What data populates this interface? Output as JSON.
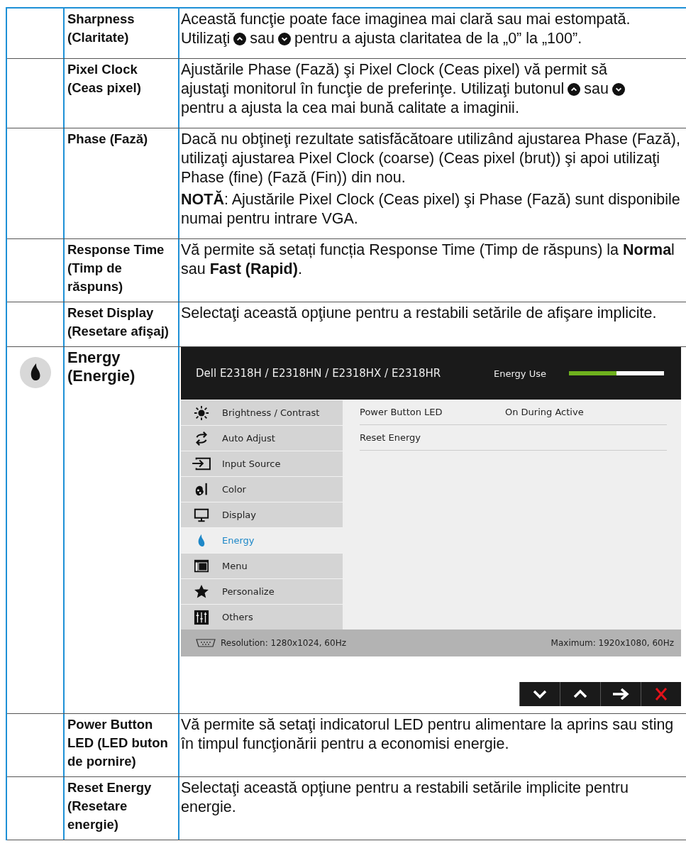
{
  "rows": [
    {
      "name": "Sharpness (Claritate)",
      "paragraphs": [
        {
          "lines": [
            [
              {
                "kind": "text",
                "text": "Această funcţie poate face imaginea mai clară sau mai estompată."
              }
            ],
            [
              {
                "kind": "text",
                "text": "Utilizaţi"
              },
              {
                "kind": "up"
              },
              {
                "kind": "text",
                "text": "sau"
              },
              {
                "kind": "down"
              },
              {
                "kind": "text",
                "text": "pentru a ajusta claritatea de la „0” la „100”."
              }
            ]
          ]
        }
      ]
    },
    {
      "name": "Pixel Clock (Ceas pixel)",
      "paragraphs": [
        {
          "lines": [
            [
              {
                "kind": "text",
                "text": "Ajustările Phase (Fază) şi Pixel Clock (Ceas pixel) vă permit să"
              }
            ],
            [
              {
                "kind": "text",
                "text": "ajustaţi monitorul în funcţie de preferinţe. Utilizaţi butonul"
              },
              {
                "kind": "up"
              },
              {
                "kind": "text",
                "text": "sau"
              },
              {
                "kind": "down"
              }
            ],
            [
              {
                "kind": "text",
                "text": "pentru a ajusta la cea mai bună calitate a imaginii."
              }
            ]
          ]
        }
      ]
    },
    {
      "name": "Phase (Fază)",
      "paragraphs": [
        {
          "text": "Dacă nu obţineţi rezultate satisfăcătoare utilizând ajustarea Phase (Fază), utilizaţi ajustarea Pixel Clock (coarse) (Ceas pixel (brut)) şi apoi utilizaţi Phase (fine) (Fază (Fin)) din nou."
        },
        {
          "text": "**NOTĂ**: Ajustările Pixel Clock (Ceas pixel) şi Phase (Fază) sunt disponibile numai pentru intrare VGA."
        }
      ]
    },
    {
      "name": "Response Time (Timp de răspuns)",
      "paragraphs": [
        {
          "text": "Vă permite să setați funcția Response Time (Timp de răspuns) la **Norma**l sau **Fast (Rapid)**."
        }
      ]
    },
    {
      "name": "Reset Display (Resetare afişaj)",
      "paragraphs": [
        {
          "text": "Selectaţi această opţiune pentru a restabili setările de afişare implicite."
        }
      ]
    },
    {
      "name": "Energy (Energie)",
      "osd": {
        "title": "Dell E2318H / E2318HN / E2318HX / E2318HR",
        "meter_label": "Energy Use",
        "level": 0.5,
        "menu": [
          {
            "label": "Brightness / Contrast",
            "selected": false
          },
          {
            "label": "Auto Adjust",
            "selected": false
          },
          {
            "label": "Input Source",
            "selected": false
          },
          {
            "label": "Color",
            "selected": false
          },
          {
            "label": "Display",
            "selected": false
          },
          {
            "label": "Energy",
            "selected": true
          },
          {
            "label": "Menu",
            "selected": false
          },
          {
            "label": "Personalize",
            "selected": false
          },
          {
            "label": "Others",
            "selected": false
          }
        ],
        "settings": [
          {
            "label": "Power Button LED",
            "value": "On During Active"
          },
          {
            "label": "Reset Energy"
          }
        ],
        "resolution": "Resolution: 1280x1024, 60Hz",
        "maximum": "Maximum: 1920x1080, 60Hz",
        "nav": [
          {
            "kind": "down"
          },
          {
            "kind": "up"
          },
          {
            "kind": "right"
          },
          {
            "kind": "close"
          }
        ]
      }
    },
    {
      "name": "Power Button LED (LED buton de pornire)",
      "paragraphs": [
        {
          "text": "Vă permite să setaţi indicatorul LED pentru alimentare la aprins sau sting în timpul funcţionării pentru a economisi energie."
        }
      ]
    },
    {
      "name": "Reset Energy (Resetare energie)",
      "paragraphs": [
        {
          "text": "Selectaţi această opţiune pentru a restabili setările implicite pentru energie."
        }
      ]
    }
  ]
}
